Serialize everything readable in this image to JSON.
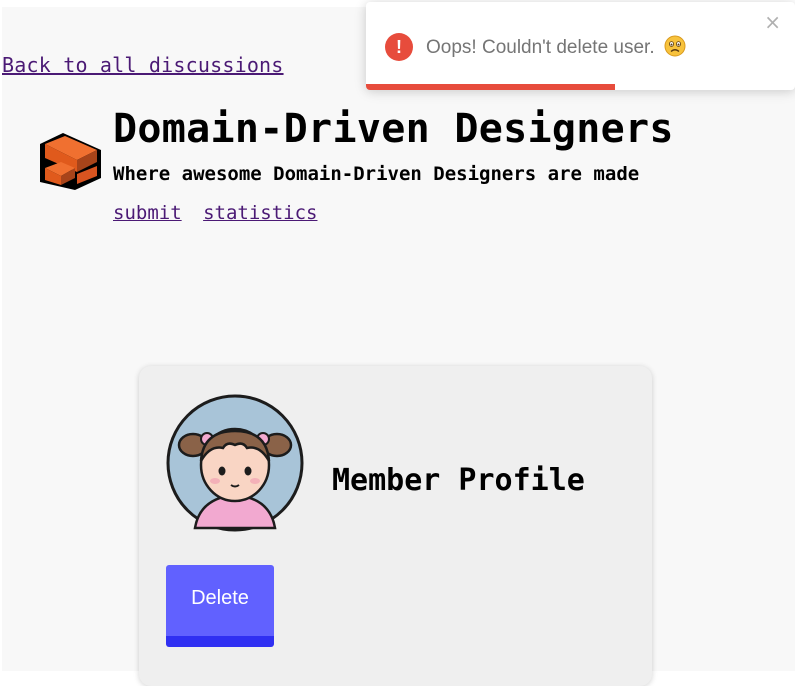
{
  "nav": {
    "back_label": "Back to all discussions",
    "links": [
      {
        "label": "submit"
      },
      {
        "label": "statistics"
      }
    ]
  },
  "header": {
    "title": "Domain-Driven Designers",
    "subtitle": "Where awesome Domain-Driven Designers are made"
  },
  "profile": {
    "heading": "Member Profile",
    "delete_label": "Delete"
  },
  "toast": {
    "icon": "exclamation-icon",
    "icon_glyph": "!",
    "message": "Oops! Couldn't delete user.",
    "emoji": "frowning-face-icon",
    "close_glyph": "×",
    "progress": 0.58,
    "color": "#e74c3c"
  },
  "colors": {
    "link": "#4b1a75",
    "button": "#6161ff",
    "button_shadow": "#2f2ff2",
    "background": "#f8f8f8",
    "card": "#efefef"
  }
}
